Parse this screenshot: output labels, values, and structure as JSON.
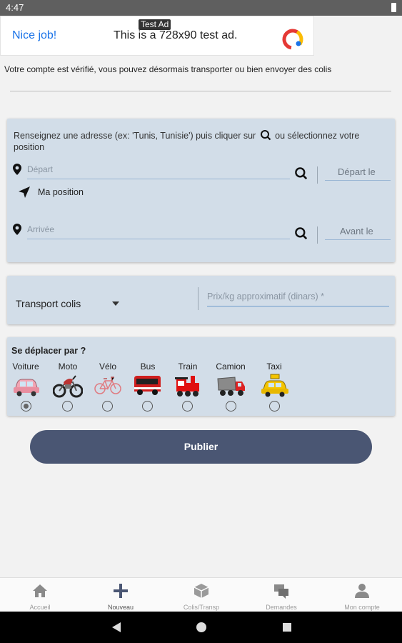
{
  "status_bar": {
    "time": "4:47"
  },
  "ad": {
    "tag": "Test Ad",
    "nice": "Nice job!",
    "text": "This is a 728x90 test ad."
  },
  "message": "Votre compte est vérifié, vous pouvez désormais transporter ou bien envoyer des colis",
  "address_card": {
    "hint": "Renseignez une adresse (ex: 'Tunis, Tunisie') puis cliquer sur",
    "hint_end": "ou sélectionnez votre position",
    "departure_placeholder": "Départ",
    "departure_date_label": "Départ le",
    "my_position": "Ma position",
    "arrival_placeholder": "Arrivée",
    "arrival_date_label": "Avant le"
  },
  "type_card": {
    "selected_type": "Transport colis",
    "price_placeholder": "Prix/kg approximatif (dinars) *"
  },
  "vehicles_card": {
    "title": "Se déplacer par ?",
    "vehicles": [
      {
        "label": "Voiture",
        "selected": true
      },
      {
        "label": "Moto",
        "selected": false
      },
      {
        "label": "Vélo",
        "selected": false
      },
      {
        "label": "Bus",
        "selected": false
      },
      {
        "label": "Train",
        "selected": false
      },
      {
        "label": "Camion",
        "selected": false
      },
      {
        "label": "Taxi",
        "selected": false
      }
    ]
  },
  "publish_label": "Publier",
  "bottom_nav": {
    "items": [
      {
        "label": "Accueil",
        "icon": "home-icon"
      },
      {
        "label": "Nouveau",
        "icon": "plus-icon"
      },
      {
        "label": "Colis/Transp",
        "icon": "package-icon"
      },
      {
        "label": "Demandes",
        "icon": "chat-icon"
      },
      {
        "label": "Mon compte",
        "icon": "user-icon"
      }
    ]
  },
  "colors": {
    "accent": "#4a5673",
    "card": "#d2dde8",
    "link": "#1a73e8"
  }
}
